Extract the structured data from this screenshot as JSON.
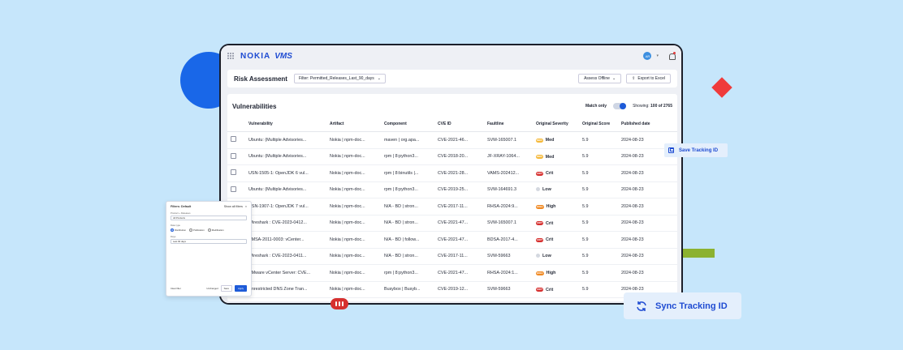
{
  "brand": {
    "nokia": "NOKIA",
    "vms": "VMS",
    "avatar": "AR"
  },
  "risk": {
    "title": "Risk Assessment",
    "filter": "Filter: Permitted_Releases_Last_90_days",
    "assess_offline": "Assess Offline",
    "export": "Export to Excel"
  },
  "vuln": {
    "title": "Vulnerabilities",
    "match_only": "Match only",
    "showing_label": "Showing:",
    "showing_value": "100 of 2765",
    "columns": [
      "Vulnerability",
      "Artifact",
      "Component",
      "CVE ID",
      "Faultline",
      "Original Severity",
      "Original Score",
      "Published date"
    ],
    "rows": [
      {
        "vuln": "Ubuntu: (Multiple Advisories...",
        "artifact": "Nokia | npm-doc...",
        "component": "maven | org.apa...",
        "cve": "CVE-2021-46...",
        "faultline": "SVM-165007.1",
        "sev": "Med",
        "score": "5.9",
        "date": "2024-08-23"
      },
      {
        "vuln": "Ubuntu: (Multiple Advisories...",
        "artifact": "Nokia | npm-doc...",
        "component": "rpm | 8:python3...",
        "cve": "CVE-2018-20...",
        "faultline": "JF-XRAY-1064...",
        "sev": "Med",
        "score": "5.9",
        "date": "2024-08-23"
      },
      {
        "vuln": "USN-1505-1: OpenJDK 6 vul...",
        "artifact": "Nokia | npm-doc...",
        "component": "rpm | 8:binutils |...",
        "cve": "CVE-2021-28...",
        "faultline": "VAMS-202412...",
        "sev": "Crit",
        "score": "5.9",
        "date": "2024-08-23"
      },
      {
        "vuln": "Ubuntu: (Multiple Advisories...",
        "artifact": "Nokia | npm-doc...",
        "component": "rpm | 8:python3...",
        "cve": "CVE-2019-25...",
        "faultline": "SVM-164691.3",
        "sev": "Low",
        "score": "5.9",
        "date": "2024-08-23"
      },
      {
        "vuln": "USN-1907-1: OpenJDK 7 vul...",
        "artifact": "Nokia | npm-doc...",
        "component": "N/A - BD | stron...",
        "cve": "CVE-2017-11...",
        "faultline": "RHSA-2024:9...",
        "sev": "High",
        "score": "5.9",
        "date": "2024-08-23"
      },
      {
        "vuln": "Wireshark : CVE-2023-0412...",
        "artifact": "Nokia | npm-doc...",
        "component": "N/A - BD | stron...",
        "cve": "CVE-2021-47...",
        "faultline": "SVM-165007.1",
        "sev": "Crit",
        "score": "5.9",
        "date": "2024-08-23"
      },
      {
        "vuln": "VMSA-2011-0003: vCenter...",
        "artifact": "Nokia | npm-doc...",
        "component": "N/A - BD | follow...",
        "cve": "CVE-2021-47...",
        "faultline": "BDSA-2017-4...",
        "sev": "Crit",
        "score": "5.9",
        "date": "2024-08-23"
      },
      {
        "vuln": "Wireshark : CVE-2023-0411...",
        "artifact": "Nokia | npm-doc...",
        "component": "N/A - BD | stron...",
        "cve": "CVE-2017-11...",
        "faultline": "SVM-59663",
        "sev": "Low",
        "score": "5.9",
        "date": "2024-08-23"
      },
      {
        "vuln": "VMware vCenter Server: CVE...",
        "artifact": "Nokia | npm-doc...",
        "component": "rpm | 8:python3...",
        "cve": "CVE-2021-47...",
        "faultline": "RHSA-2024:1...",
        "sev": "High",
        "score": "5.9",
        "date": "2024-08-23"
      },
      {
        "vuln": "Unrestricted DNS Zone Tran...",
        "artifact": "Nokia | npm-doc...",
        "component": "Busybox | Busyb...",
        "cve": "CVE-2019-12...",
        "faultline": "SVM-59663",
        "sev": "Crit",
        "score": "5.9",
        "date": "2024-08-23"
      }
    ]
  },
  "severity_colors": {
    "Crit": "#d6302f",
    "High": "#f08a24",
    "Med": "#f5b93a",
    "Low": "#d4d8e0"
  },
  "severity_dot_text": {
    "Crit": "CRIT",
    "High": "HIGH",
    "Med": "MED",
    "Low": ""
  },
  "save_tracking": "Save Tracking ID",
  "sync_tracking": "Sync Tracking ID",
  "filters_panel": {
    "title": "Filters: Default",
    "show_all": "Show all filters",
    "product_label": "Product + Releases",
    "product_value": "All Products",
    "date_label": "Date type",
    "radios": [
      "Distribution",
      "Publication",
      "Modification"
    ],
    "days_label": "Days",
    "days_value": "Last 90 days",
    "clear": "Clear filter",
    "unchanged": "Unchanged",
    "save": "Save",
    "apply": "Apply"
  }
}
